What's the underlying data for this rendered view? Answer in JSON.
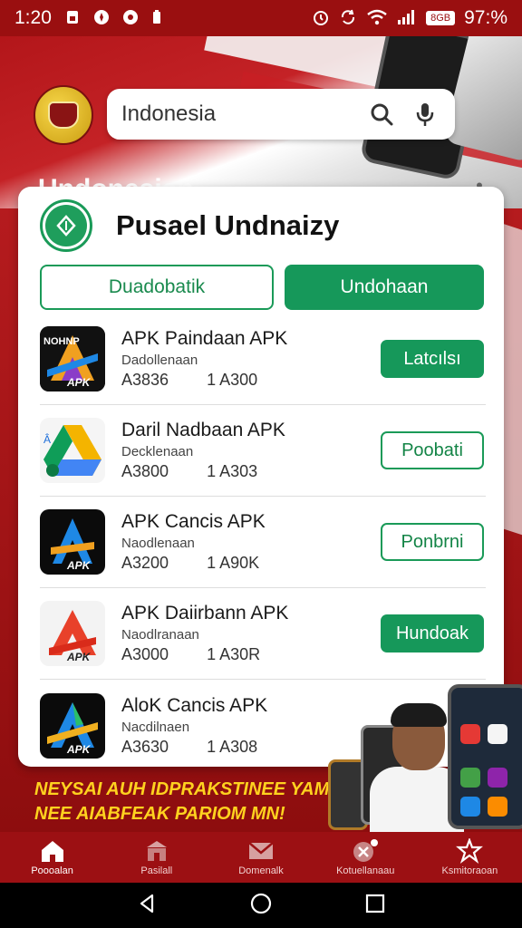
{
  "status_bar": {
    "time": "1:20",
    "battery": "97:%",
    "left_icons": [
      "sim-card-icon",
      "compass-icon",
      "settings-app-icon",
      "battery-small-icon"
    ],
    "right_icons": [
      "alarm-icon",
      "sync-icon",
      "wifi-icon",
      "signal-icon",
      "network-badge-icon"
    ],
    "network_badge": "8GB"
  },
  "header": {
    "search_text": "Indonesia",
    "title": "Undonesian"
  },
  "store": {
    "name": "Pusael Undnaizy",
    "tabs": [
      {
        "label": "Duadobatik",
        "active": false
      },
      {
        "label": "Undohaan",
        "active": true
      }
    ]
  },
  "apps": [
    {
      "name": "APK Paindaan APK",
      "subtitle": "Dadollenaan",
      "stat1": "A3836",
      "stat2": "1 A300",
      "button": "Latcılsı",
      "button_style": "filled"
    },
    {
      "name": "Daril Nadbaan APK",
      "subtitle": "Decklenaan",
      "stat1": "A3800",
      "stat2": "1 A303",
      "button": "Poobati",
      "button_style": "outline"
    },
    {
      "name": "APK Cancis APK",
      "subtitle": "Naodlenaan",
      "stat1": "A3200",
      "stat2": "1 A90K",
      "button": "Ponbrni",
      "button_style": "outline"
    },
    {
      "name": "APK Daiirbann APK",
      "subtitle": "Naodlranaan",
      "stat1": "A3000",
      "stat2": "1 A30R",
      "button": "Hundoak",
      "button_style": "filled"
    },
    {
      "name": "AloK Cancis APK",
      "subtitle": "Nacdilnaen",
      "stat1": "A3630",
      "stat2": "1 A308",
      "button": "",
      "button_style": "outline"
    }
  ],
  "promo": {
    "line1": "NEYSAI AUH IDPRAKSTINEE YAM",
    "line2": "NEE AIABFEAK PARIOM MN!"
  },
  "bottom_nav": [
    {
      "label": "Poooalan",
      "icon": "home-icon",
      "active": true
    },
    {
      "label": "Pasilall",
      "icon": "store-icon",
      "active": false
    },
    {
      "label": "Domenalk",
      "icon": "mail-icon",
      "active": false
    },
    {
      "label": "Kotuellanaau",
      "icon": "tools-icon",
      "active": false
    },
    {
      "label": "Ksmitoraoan",
      "icon": "ribbon-icon",
      "active": false
    }
  ],
  "colors": {
    "brand_red": "#9c1013",
    "accent_green": "#16985a",
    "promo_yellow": "#ffd21f"
  }
}
